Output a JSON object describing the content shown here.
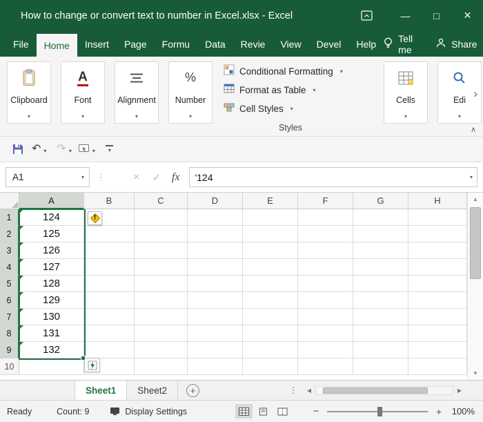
{
  "colors": {
    "title_bar_green": "#185C37",
    "accent_green": "#217346",
    "header_accent_green": "#107C41",
    "warning_yellow": "#FFC000",
    "font_underline_red": "#C00000"
  },
  "title_bar": {
    "title": "How to change or convert text to number in Excel.xlsx - Excel"
  },
  "menu": {
    "tabs": [
      {
        "label": "File",
        "active": false
      },
      {
        "label": "Home",
        "active": true
      },
      {
        "label": "Insert",
        "active": false
      },
      {
        "label": "Page",
        "active": false
      },
      {
        "label": "Formu",
        "active": false
      },
      {
        "label": "Data",
        "active": false
      },
      {
        "label": "Revie",
        "active": false
      },
      {
        "label": "View",
        "active": false
      },
      {
        "label": "Devel",
        "active": false
      },
      {
        "label": "Help",
        "active": false
      }
    ],
    "tell_me": "Tell me",
    "share": "Share"
  },
  "ribbon": {
    "groups": {
      "clipboard": "Clipboard",
      "font": "Font",
      "alignment": "Alignment",
      "number": "Number",
      "cells": "Cells",
      "editing": "Edi"
    },
    "styles": {
      "buttons": [
        "Conditional Formatting",
        "Format as Table",
        "Cell Styles"
      ],
      "label": "Styles"
    }
  },
  "formula_bar": {
    "name_box": "A1",
    "formula": "'124"
  },
  "grid": {
    "columns": [
      "A",
      "B",
      "C",
      "D",
      "E",
      "F",
      "G",
      "H"
    ],
    "rows": [
      "1",
      "2",
      "3",
      "4",
      "5",
      "6",
      "7",
      "8",
      "9",
      "10"
    ],
    "values": [
      "124",
      "125",
      "126",
      "127",
      "128",
      "129",
      "130",
      "131",
      "132"
    ],
    "selection": "A1:A9"
  },
  "sheets": {
    "tabs": [
      {
        "label": "Sheet1",
        "active": true
      },
      {
        "label": "Sheet2",
        "active": false
      }
    ]
  },
  "status_bar": {
    "mode": "Ready",
    "count": "Count: 9",
    "display_settings": "Display Settings",
    "zoom_level": "100%"
  },
  "icons": {
    "dropdown": "▾",
    "collapse_ribbon": "∧",
    "overflow_right": "›",
    "minimize": "—",
    "maximize": "□",
    "close": "×",
    "undo": "↶",
    "redo": "↷",
    "cancel": "×",
    "enter": "✓",
    "fx": "fx",
    "sizer_dots": "⋮",
    "new_sheet": "+",
    "tab_dots": "⋮",
    "scroll_left": "◀",
    "scroll_right": "▶",
    "scroll_up": "▲",
    "scroll_down": "▼",
    "warning_mark": "!",
    "font_icon": "A",
    "percent": "%"
  }
}
